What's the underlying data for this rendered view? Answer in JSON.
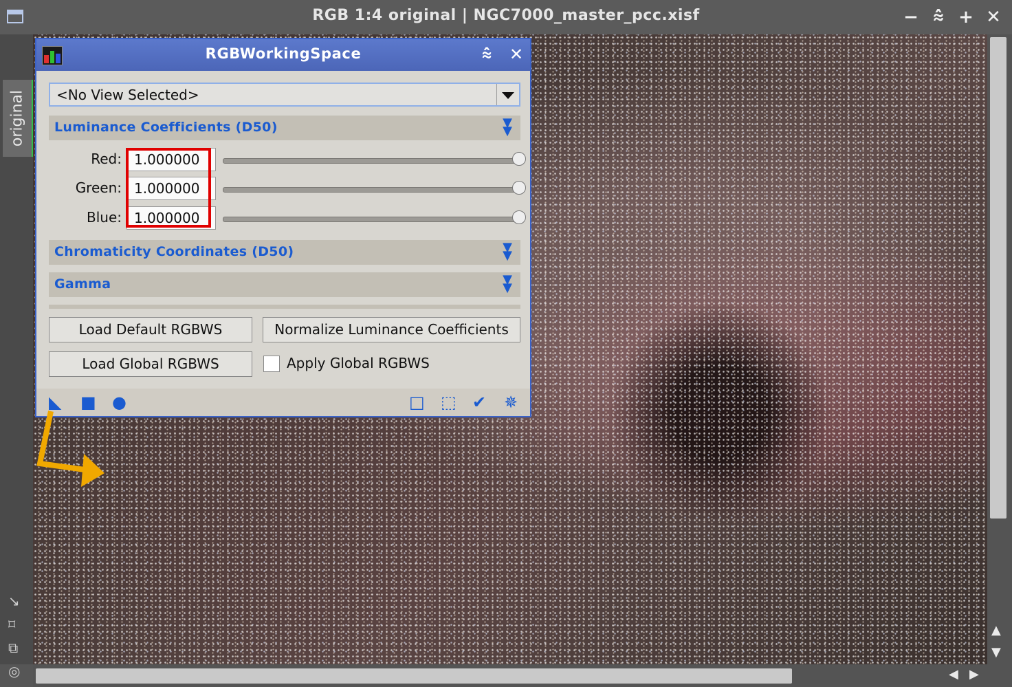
{
  "window": {
    "title": "RGB 1:4 original | NGC7000_master_pcc.xisf",
    "tab_label": "original"
  },
  "dialog": {
    "title": "RGBWorkingSpace",
    "view_select": "<No View Selected>",
    "sections": {
      "luminance": "Luminance Coefficients (D50)",
      "chromaticity": "Chromaticity Coordinates (D50)",
      "gamma": "Gamma"
    },
    "coefficients": [
      {
        "label": "Red:",
        "value": "1.000000",
        "slider": 1.0
      },
      {
        "label": "Green:",
        "value": "1.000000",
        "slider": 1.0
      },
      {
        "label": "Blue:",
        "value": "1.000000",
        "slider": 1.0
      }
    ],
    "buttons": {
      "load_default": "Load Default RGBWS",
      "normalize": "Normalize Luminance Coefficients",
      "load_global": "Load Global RGBWS"
    },
    "checkbox": {
      "label": "Apply Global RGBWS",
      "checked": false
    }
  },
  "colors": {
    "accent": "#1a5bd0",
    "title_bar": "#4c66b8",
    "highlight": "#e00000",
    "annotation_arrow": "#f0a800"
  }
}
